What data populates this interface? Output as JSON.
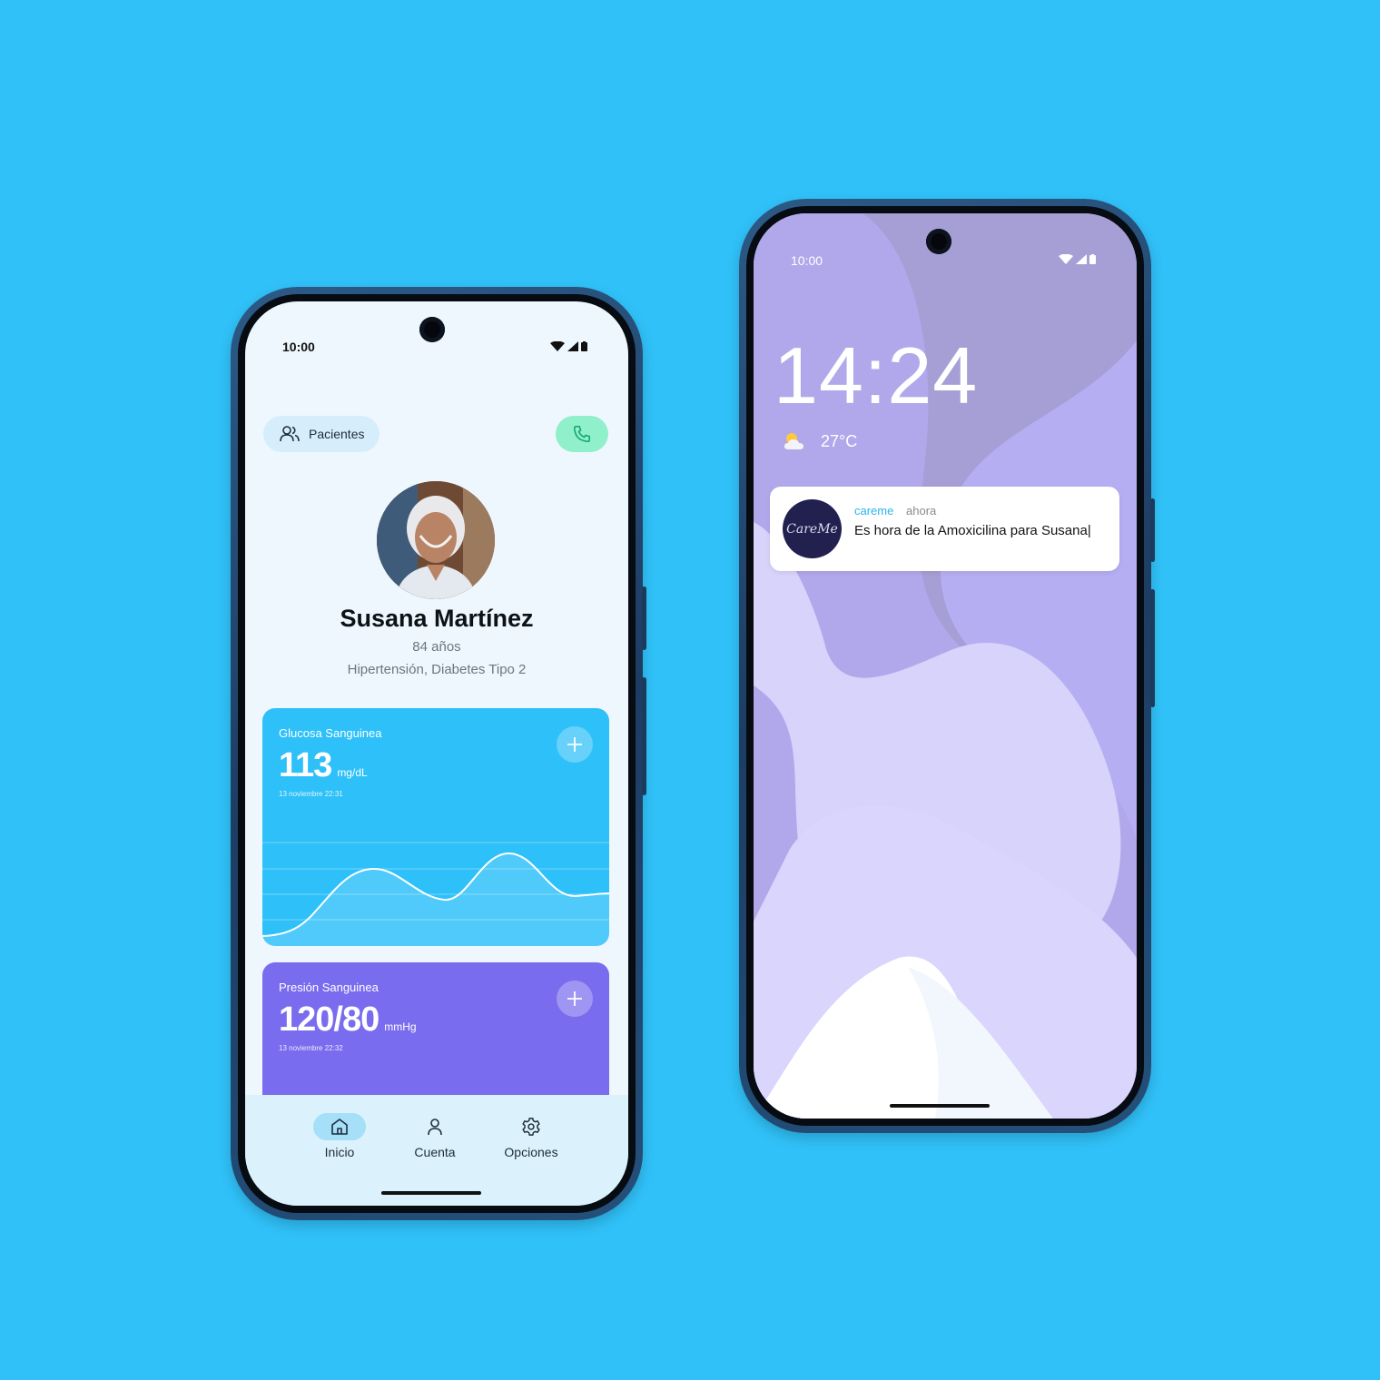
{
  "colors": {
    "background": "#30c1f8",
    "glucose_card": "#2ec0f9",
    "pressure_card": "#7a6cee",
    "call_button": "#8ff0cb",
    "notification_app": "#2ab5ec"
  },
  "phone1": {
    "status_time": "10:00",
    "patients_button": {
      "label": "Pacientes",
      "icon": "users-icon"
    },
    "call_button_icon": "phone-icon",
    "profile": {
      "name": "Susana Martínez",
      "age": "84 años",
      "conditions": "Hipertensión, Diabetes Tipo 2"
    },
    "glucose_card": {
      "title": "Glucosa Sanguinea",
      "value": "113",
      "unit": "mg/dL",
      "date": "13 noviembre 22:31"
    },
    "pressure_card": {
      "title": "Presión Sanguinea",
      "value": "120/80",
      "unit": "mmHg",
      "date": "13 noviembre 22:32"
    },
    "nav": [
      {
        "label": "Inicio",
        "icon": "home-icon",
        "active": true
      },
      {
        "label": "Cuenta",
        "icon": "user-icon",
        "active": false
      },
      {
        "label": "Opciones",
        "icon": "gear-icon",
        "active": false
      }
    ]
  },
  "phone2": {
    "status_time": "10:00",
    "lock_time": "14:24",
    "weather": {
      "temperature": "27°C",
      "icon": "partly-cloudy-icon"
    },
    "notification": {
      "logo_text": "CareMe",
      "app": "careme",
      "time": "ahora",
      "message": "Es hora de la Amoxicilina para Susana|"
    }
  }
}
